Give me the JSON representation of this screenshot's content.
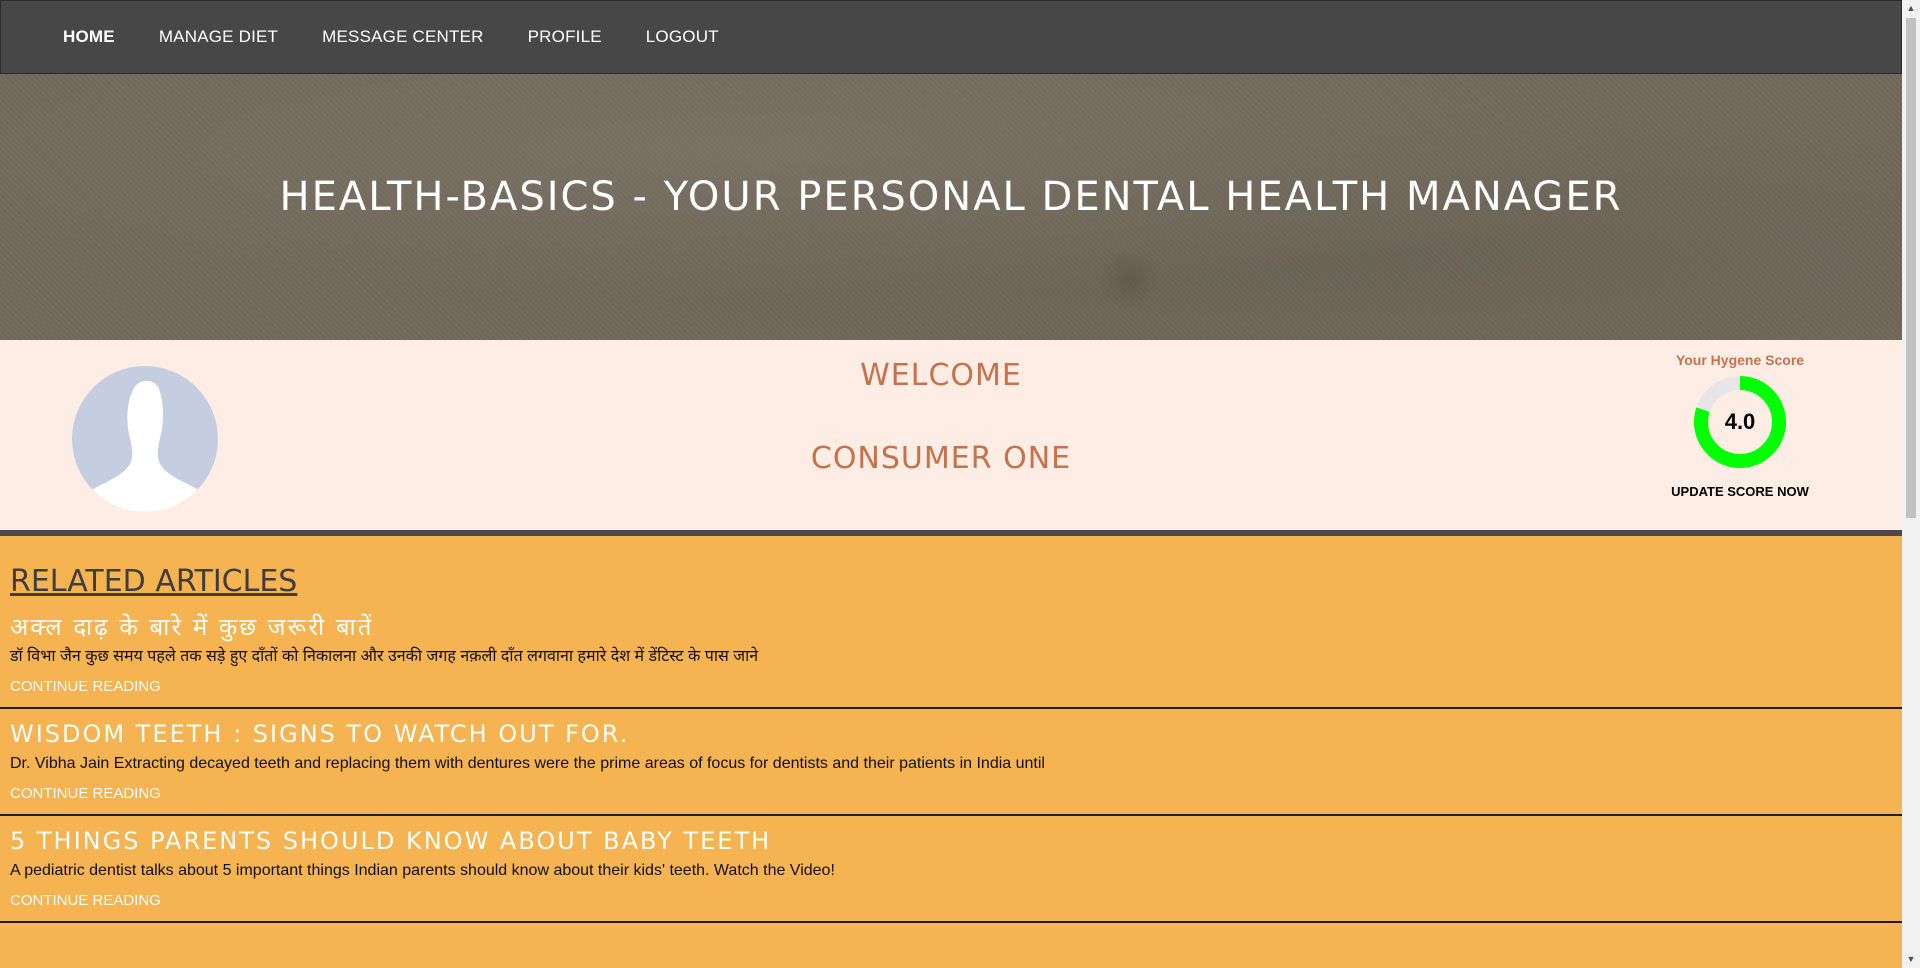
{
  "nav": {
    "items": [
      "HOME",
      "MANAGE DIET",
      "MESSAGE CENTER",
      "PROFILE",
      "LOGOUT"
    ]
  },
  "hero": {
    "title": "HEALTH-BASICS - YOUR PERSONAL DENTAL HEALTH MANAGER"
  },
  "welcome": {
    "title": "WELCOME",
    "name": "CONSUMER ONE",
    "score_label": "Your Hygene Score",
    "score_value": "4.0",
    "score_fraction": 0.8,
    "score_link": "UPDATE SCORE NOW",
    "gauge_color": "#00ff00"
  },
  "articles": {
    "heading": "RELATED ARTICLES",
    "items": [
      {
        "title": "अक्ल दाढ़ के बारे में कुछ जरूरी बातें",
        "excerpt": "डॉ विभा जैन  कुछ समय पहले तक सड़े हुए दाँतों को निकालना और उनकी जगह नक़ली दाँत लगवाना हमारे देश में डेंटिस्ट के पास जाने",
        "link": "CONTINUE READING"
      },
      {
        "title": "WISDOM TEETH : SIGNS TO WATCH OUT FOR.",
        "excerpt": "Dr. Vibha Jain Extracting decayed teeth and replacing them with dentures were the prime areas of focus for dentists and their patients in India until",
        "link": "CONTINUE READING"
      },
      {
        "title": "5 THINGS PARENTS SHOULD KNOW ABOUT BABY TEETH",
        "excerpt": "A pediatric dentist talks about 5 important things Indian parents should know about their kids' teeth. Watch the Video!",
        "link": "CONTINUE READING"
      }
    ]
  }
}
